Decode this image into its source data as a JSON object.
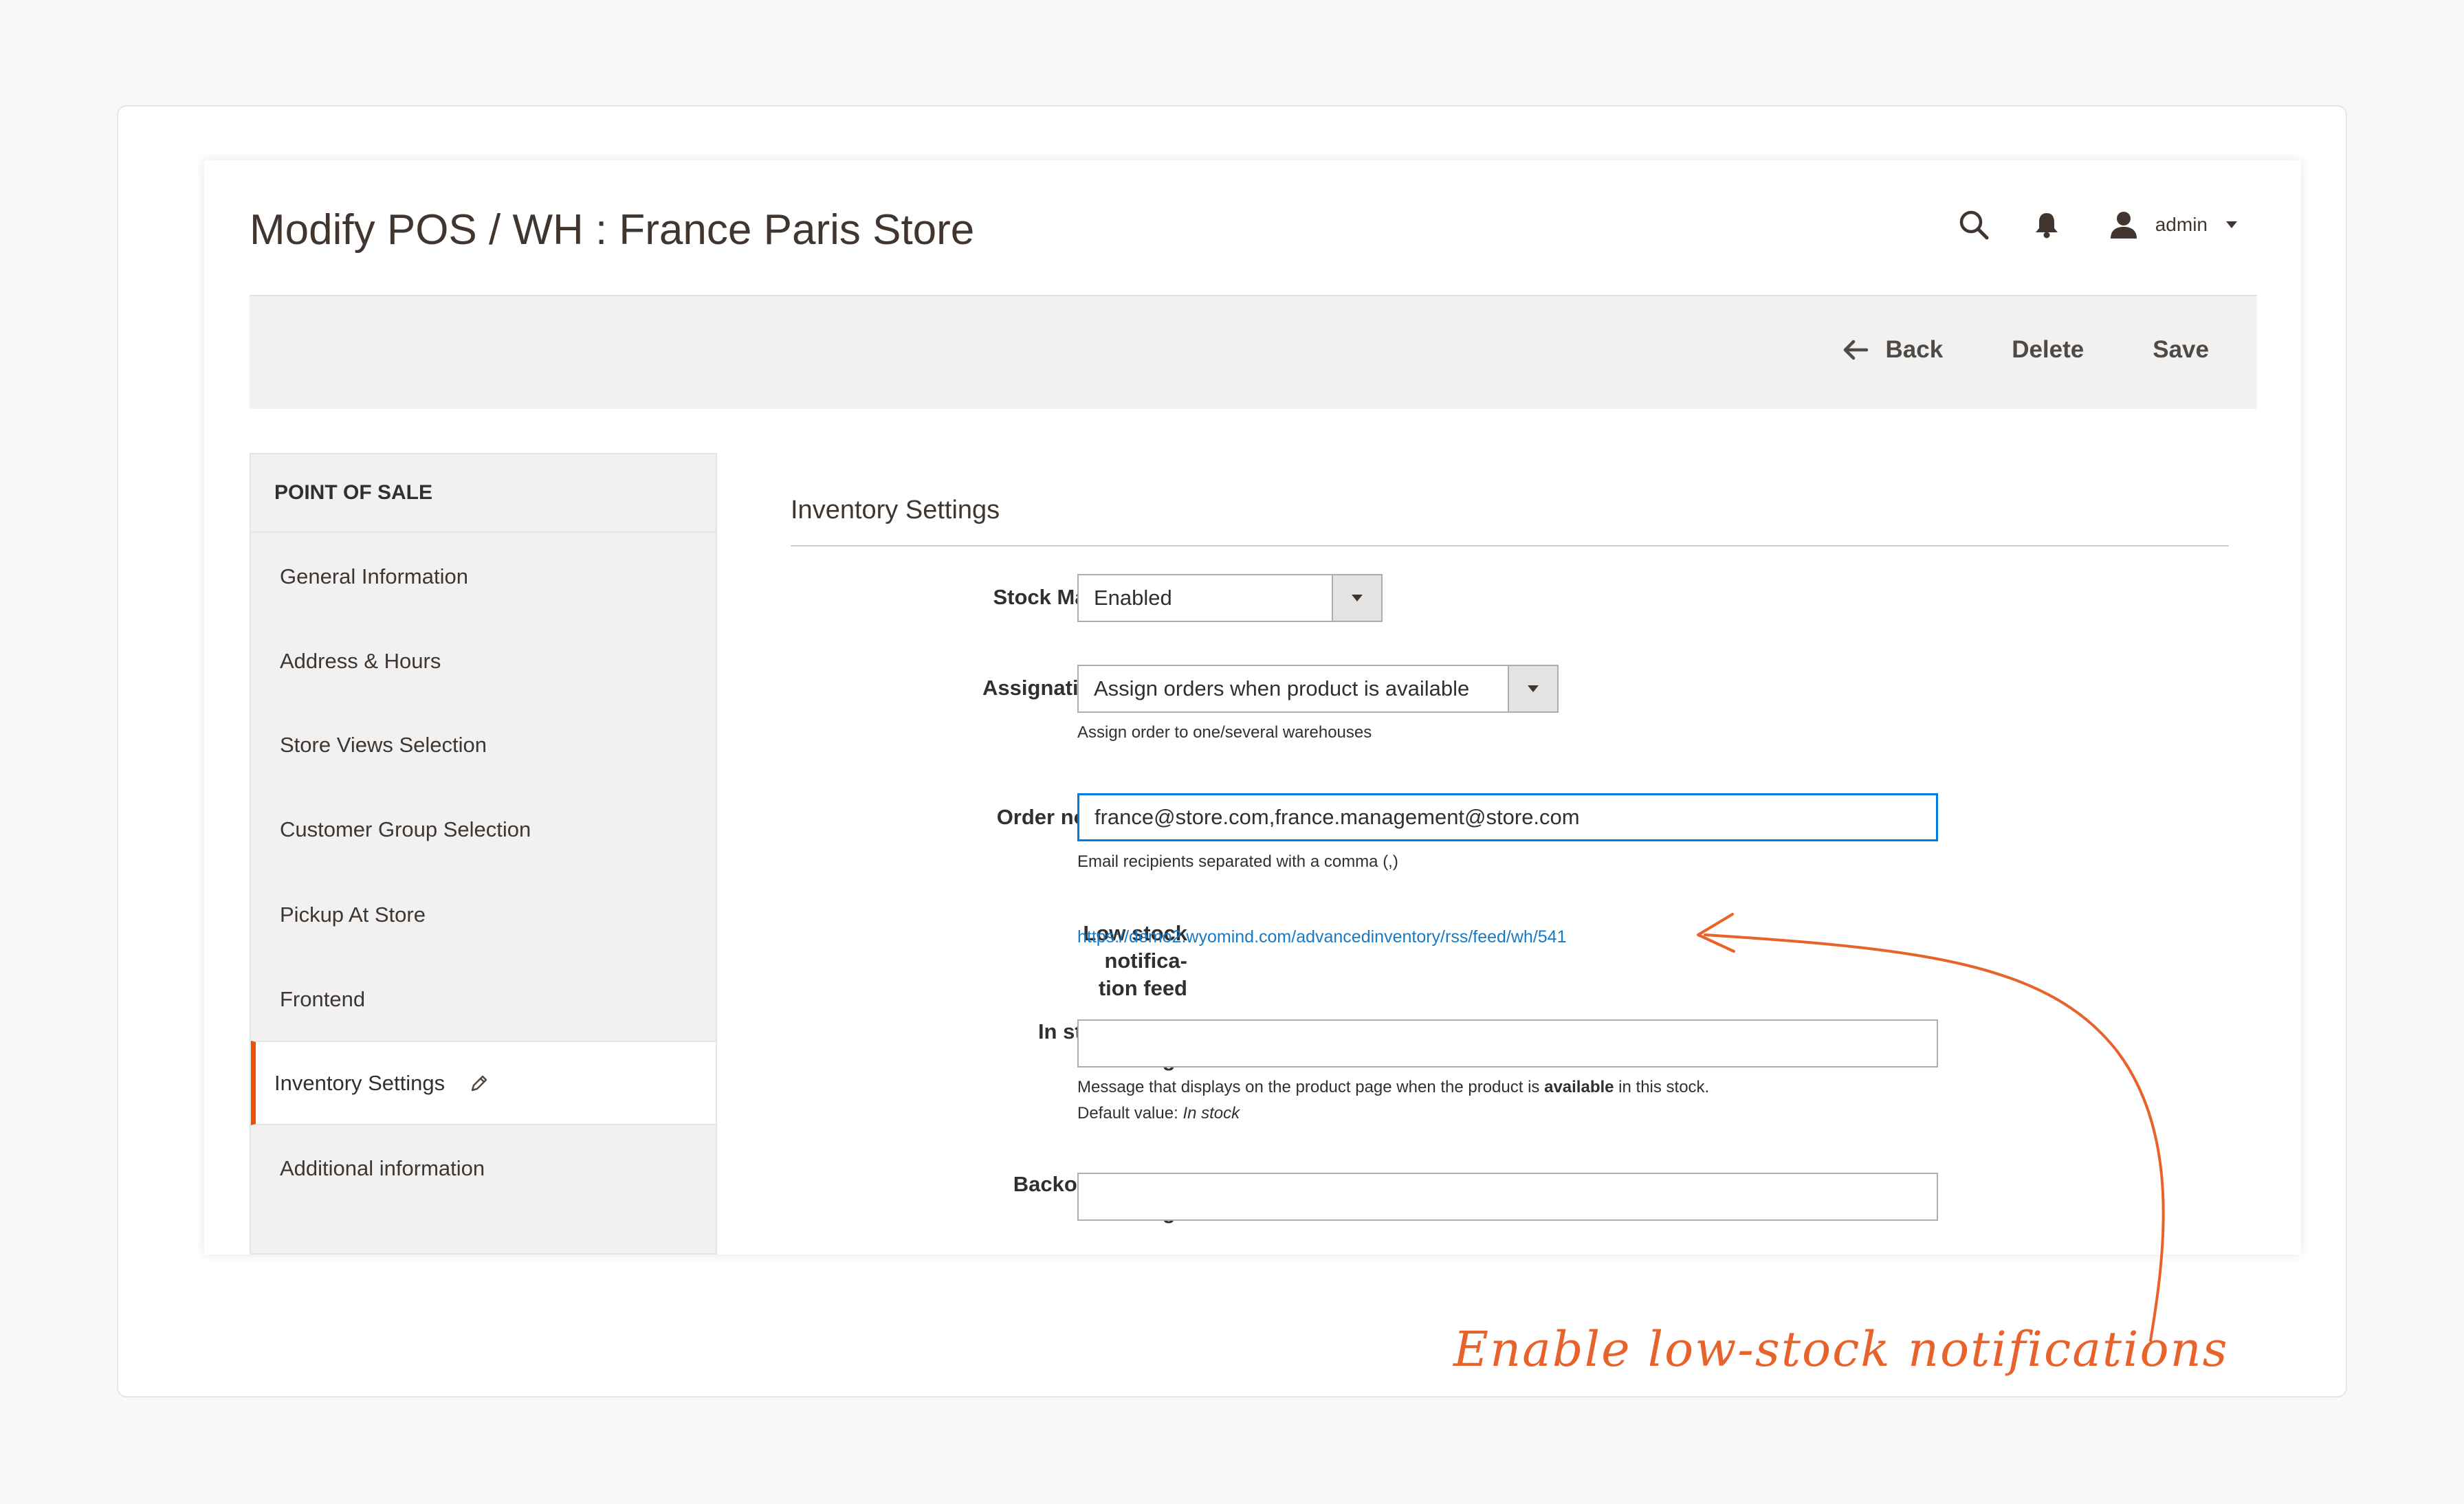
{
  "header": {
    "title": "Modify POS / WH : France Paris Store",
    "user": "admin",
    "icons": [
      "search-icon",
      "bell-icon",
      "user-icon",
      "caret-down-icon"
    ]
  },
  "actions": {
    "back": "Back",
    "delete": "Delete",
    "save": "Save"
  },
  "sidebar": {
    "heading": "POINT OF SALE",
    "items": [
      {
        "label": "General Information"
      },
      {
        "label": "Address & Hours"
      },
      {
        "label": "Store Views Selection"
      },
      {
        "label": "Customer Group Selection"
      },
      {
        "label": "Pickup At Store"
      },
      {
        "label": "Frontend"
      },
      {
        "label": "Inventory Settings",
        "active": true
      },
      {
        "label": "Additional information"
      }
    ]
  },
  "form": {
    "section_title": "Inventory Settings",
    "stock_management": {
      "label": "Stock Management",
      "value": "Enabled"
    },
    "assignation_method": {
      "label": "Assignation method",
      "value": "Assign orders when product is available",
      "note": "Assign order to one/several warehouses"
    },
    "order_notifications": {
      "label": "Order notifications",
      "value": "france@store.com,france.management@store.com",
      "note": "Email recipients separated with a comma (,)"
    },
    "low_stock_feed": {
      "label_line1": "Low stock notifica-",
      "label_line2": "tion feed",
      "url": "https://demo2.wyomind.com/advancedinventory/rss/feed/wh/541"
    },
    "in_stock_message": {
      "label_line1": "In stock status",
      "label_line2": "message",
      "value": "",
      "note_prefix": "Message that displays on the product page when the product is",
      "note_bold": "available",
      "note_suffix": "in this stock.",
      "default_prefix": "Default value:",
      "default_value": "In stock"
    },
    "backorder_message": {
      "label_line1": "Backorder status",
      "label_line2": "message",
      "value": ""
    }
  },
  "annotation": {
    "text": "Enable low-stock notifications",
    "color": "#e8632c"
  },
  "colors": {
    "accent": "#eb5202",
    "link": "#1979c3",
    "focus": "#007bdb"
  }
}
